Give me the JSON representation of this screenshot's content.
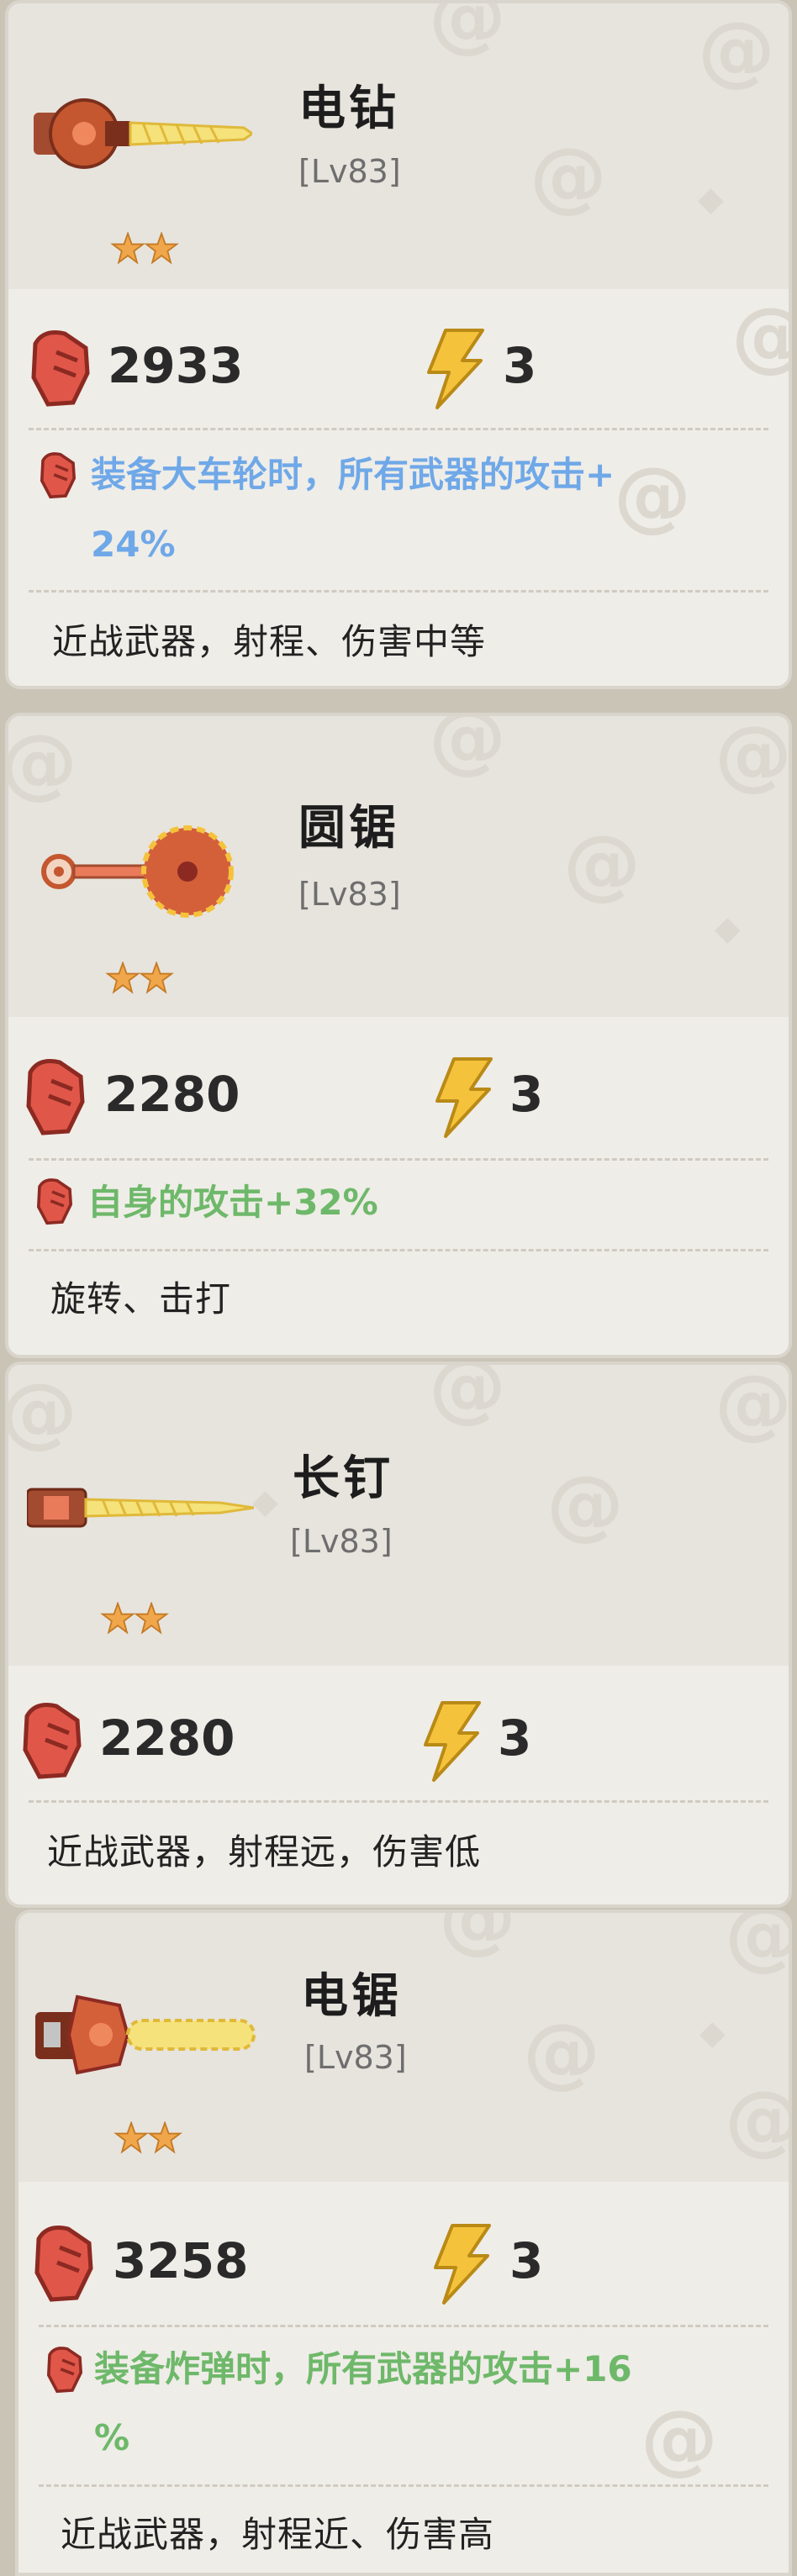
{
  "cards": [
    {
      "name": "电钻",
      "level": "[Lv83]",
      "attack": "2933",
      "energy": "3",
      "bonus_line1": "装备大车轮时，所有武器的攻击+",
      "bonus_line2": "24%",
      "description": "近战武器，射程、伤害中等",
      "bonus_color": "#6fa8e8"
    },
    {
      "name": "圆锯",
      "level": "[Lv83]",
      "attack": "2280",
      "energy": "3",
      "bonus_line1": "自身的攻击+32%",
      "description": "旋转、击打",
      "bonus_color": "#6eb86a"
    },
    {
      "name": "长钉",
      "level": "[Lv83]",
      "attack": "2280",
      "energy": "3",
      "description": "近战武器，射程远，伤害低"
    },
    {
      "name": "电锯",
      "level": "[Lv83]",
      "attack": "3258",
      "energy": "3",
      "bonus_line1": "装备炸弹时，所有武器的攻击+16",
      "bonus_line2": "%",
      "description": "近战武器，射程近、伤害高",
      "bonus_color": "#6eb86a"
    }
  ],
  "colors": {
    "card_bg": "#efede8",
    "stat_icon_red": "#e0574a",
    "energy_yellow": "#f5c33b",
    "star_orange": "#f0a64a"
  }
}
